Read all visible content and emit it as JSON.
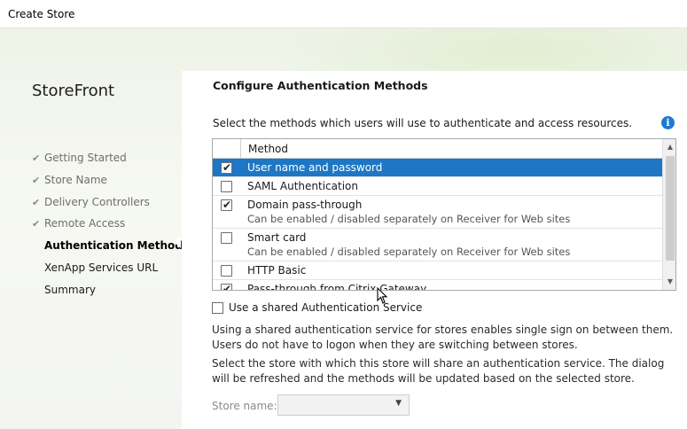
{
  "window": {
    "title": "Create Store"
  },
  "sidebar": {
    "brand": "StoreFront",
    "items": [
      {
        "label": "Getting Started",
        "state": "done"
      },
      {
        "label": "Store Name",
        "state": "done"
      },
      {
        "label": "Delivery Controllers",
        "state": "done"
      },
      {
        "label": "Remote Access",
        "state": "done"
      },
      {
        "label": "Authentication Methods",
        "state": "active"
      },
      {
        "label": "XenApp Services URL",
        "state": "todo"
      },
      {
        "label": "Summary",
        "state": "todo"
      }
    ],
    "check_glyph": "✔"
  },
  "main": {
    "heading": "Configure Authentication Methods",
    "description": "Select the methods which users will use to authenticate and access resources.",
    "info_glyph": "i",
    "table": {
      "column_header": "Method",
      "rows": [
        {
          "label": "User name and password",
          "sublabel": "",
          "checked": true,
          "selected": true
        },
        {
          "label": "SAML Authentication",
          "sublabel": "",
          "checked": false,
          "selected": false
        },
        {
          "label": "Domain pass-through",
          "sublabel": "Can be enabled / disabled separately on Receiver for Web sites",
          "checked": true,
          "selected": false
        },
        {
          "label": "Smart card",
          "sublabel": "Can be enabled / disabled separately on Receiver for Web sites",
          "checked": false,
          "selected": false
        },
        {
          "label": "HTTP Basic",
          "sublabel": "",
          "checked": false,
          "selected": false
        },
        {
          "label": "Pass-through from Citrix Gateway",
          "sublabel": "",
          "checked": true,
          "selected": false
        }
      ]
    },
    "shared_auth": {
      "label": "Use a shared Authentication Service",
      "checked": false
    },
    "paragraph1": "Using a shared authentication service for stores enables single sign on between them. Users do not have to logon when they are switching between stores.",
    "paragraph2": "Select the store with which this store will share an authentication service. The dialog will be refreshed and the methods will be updated based on the selected store.",
    "store_name": {
      "label": "Store name:",
      "value": ""
    }
  },
  "colors": {
    "selected_row": "#1e77c4",
    "info_icon": "#1f7ad1"
  }
}
